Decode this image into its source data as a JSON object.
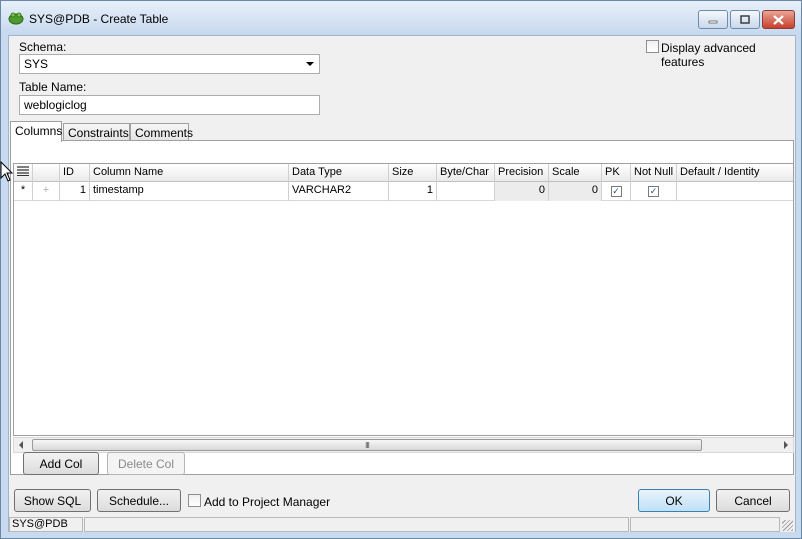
{
  "window": {
    "title": "SYS@PDB - Create Table"
  },
  "form": {
    "schema_label": "Schema:",
    "schema_value": "SYS",
    "table_name_label": "Table Name:",
    "table_name_value": "weblogiclog",
    "advanced_label": "Display advanced features"
  },
  "tabs": [
    {
      "label": "Columns"
    },
    {
      "label": "Constraints"
    },
    {
      "label": "Comments"
    }
  ],
  "grid": {
    "headers": {
      "id": "ID",
      "name": "Column Name",
      "type": "Data Type",
      "size": "Size",
      "bytechar": "Byte/Char",
      "precision": "Precision",
      "scale": "Scale",
      "pk": "PK",
      "notnull": "Not Null",
      "default": "Default / Identity"
    },
    "rows": [
      {
        "marker": "*",
        "id": "1",
        "name": "timestamp",
        "type": "VARCHAR2",
        "size": "1",
        "bytechar": "",
        "precision": "0",
        "scale": "0",
        "pk": "✓",
        "notnull": "✓",
        "default": ""
      }
    ],
    "scroll_thumb": "III"
  },
  "buttons": {
    "add_col": "Add Col",
    "delete_col": "Delete Col",
    "show_sql": "Show SQL",
    "schedule": "Schedule...",
    "add_project": "Add to Project Manager",
    "ok": "OK",
    "cancel": "Cancel"
  },
  "status": {
    "connection": "SYS@PDB"
  }
}
